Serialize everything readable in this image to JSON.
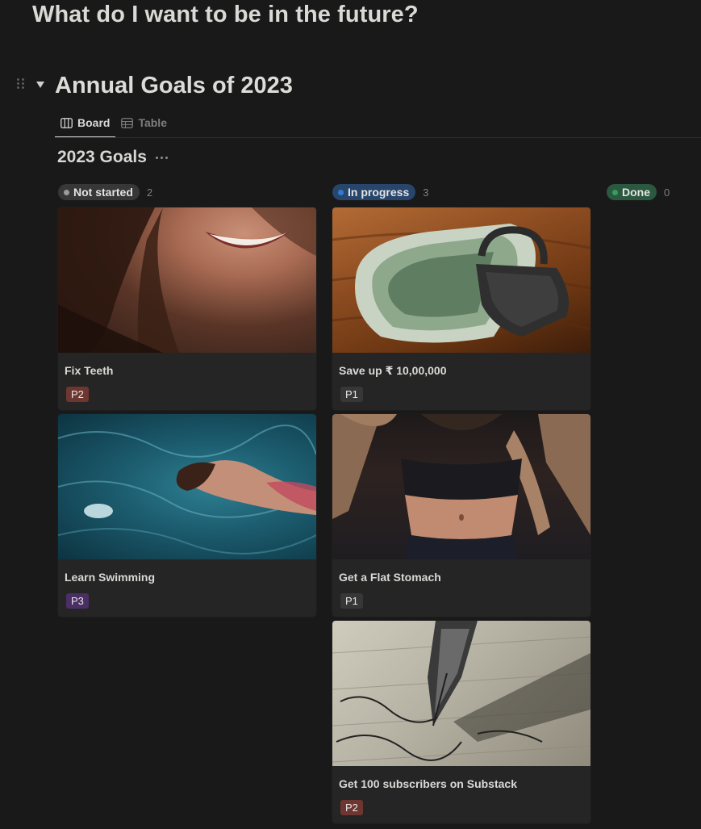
{
  "page": {
    "title": "What do I want to be in the future?"
  },
  "section": {
    "title": "Annual Goals of 2023"
  },
  "views": {
    "tabs": [
      {
        "label": "Board",
        "icon": "board-view-icon",
        "active": true
      },
      {
        "label": "Table",
        "icon": "table-view-icon",
        "active": false
      }
    ]
  },
  "database": {
    "title": "2023 Goals"
  },
  "columns": [
    {
      "status": "Not started",
      "count": "2",
      "pill_color": "#373737",
      "dot_color": "#9b9b9b",
      "cards": [
        {
          "title": "Fix Teeth",
          "priority": "P2",
          "priority_color": "#6e3630",
          "cover": "smiling-woman-photo"
        },
        {
          "title": "Learn Swimming",
          "priority": "P3",
          "priority_color": "#492f64",
          "cover": "swimming-pool-photo"
        }
      ]
    },
    {
      "status": "In progress",
      "count": "3",
      "pill_color": "#28456c",
      "dot_color": "#2e7cd1",
      "cards": [
        {
          "title": "Save up ₹ 10,00,000",
          "priority": "P1",
          "priority_color": "#373737",
          "cover": "money-padlock-photo"
        },
        {
          "title": "Get a Flat Stomach",
          "priority": "P1",
          "priority_color": "#373737",
          "cover": "flat-stomach-photo"
        },
        {
          "title": "Get 100 subscribers on Substack",
          "priority": "P2",
          "priority_color": "#6e3630",
          "cover": "fountain-pen-photo"
        }
      ]
    },
    {
      "status": "Done",
      "count": "0",
      "pill_color": "#2b593f",
      "dot_color": "#3d9a5f",
      "cards": []
    }
  ]
}
